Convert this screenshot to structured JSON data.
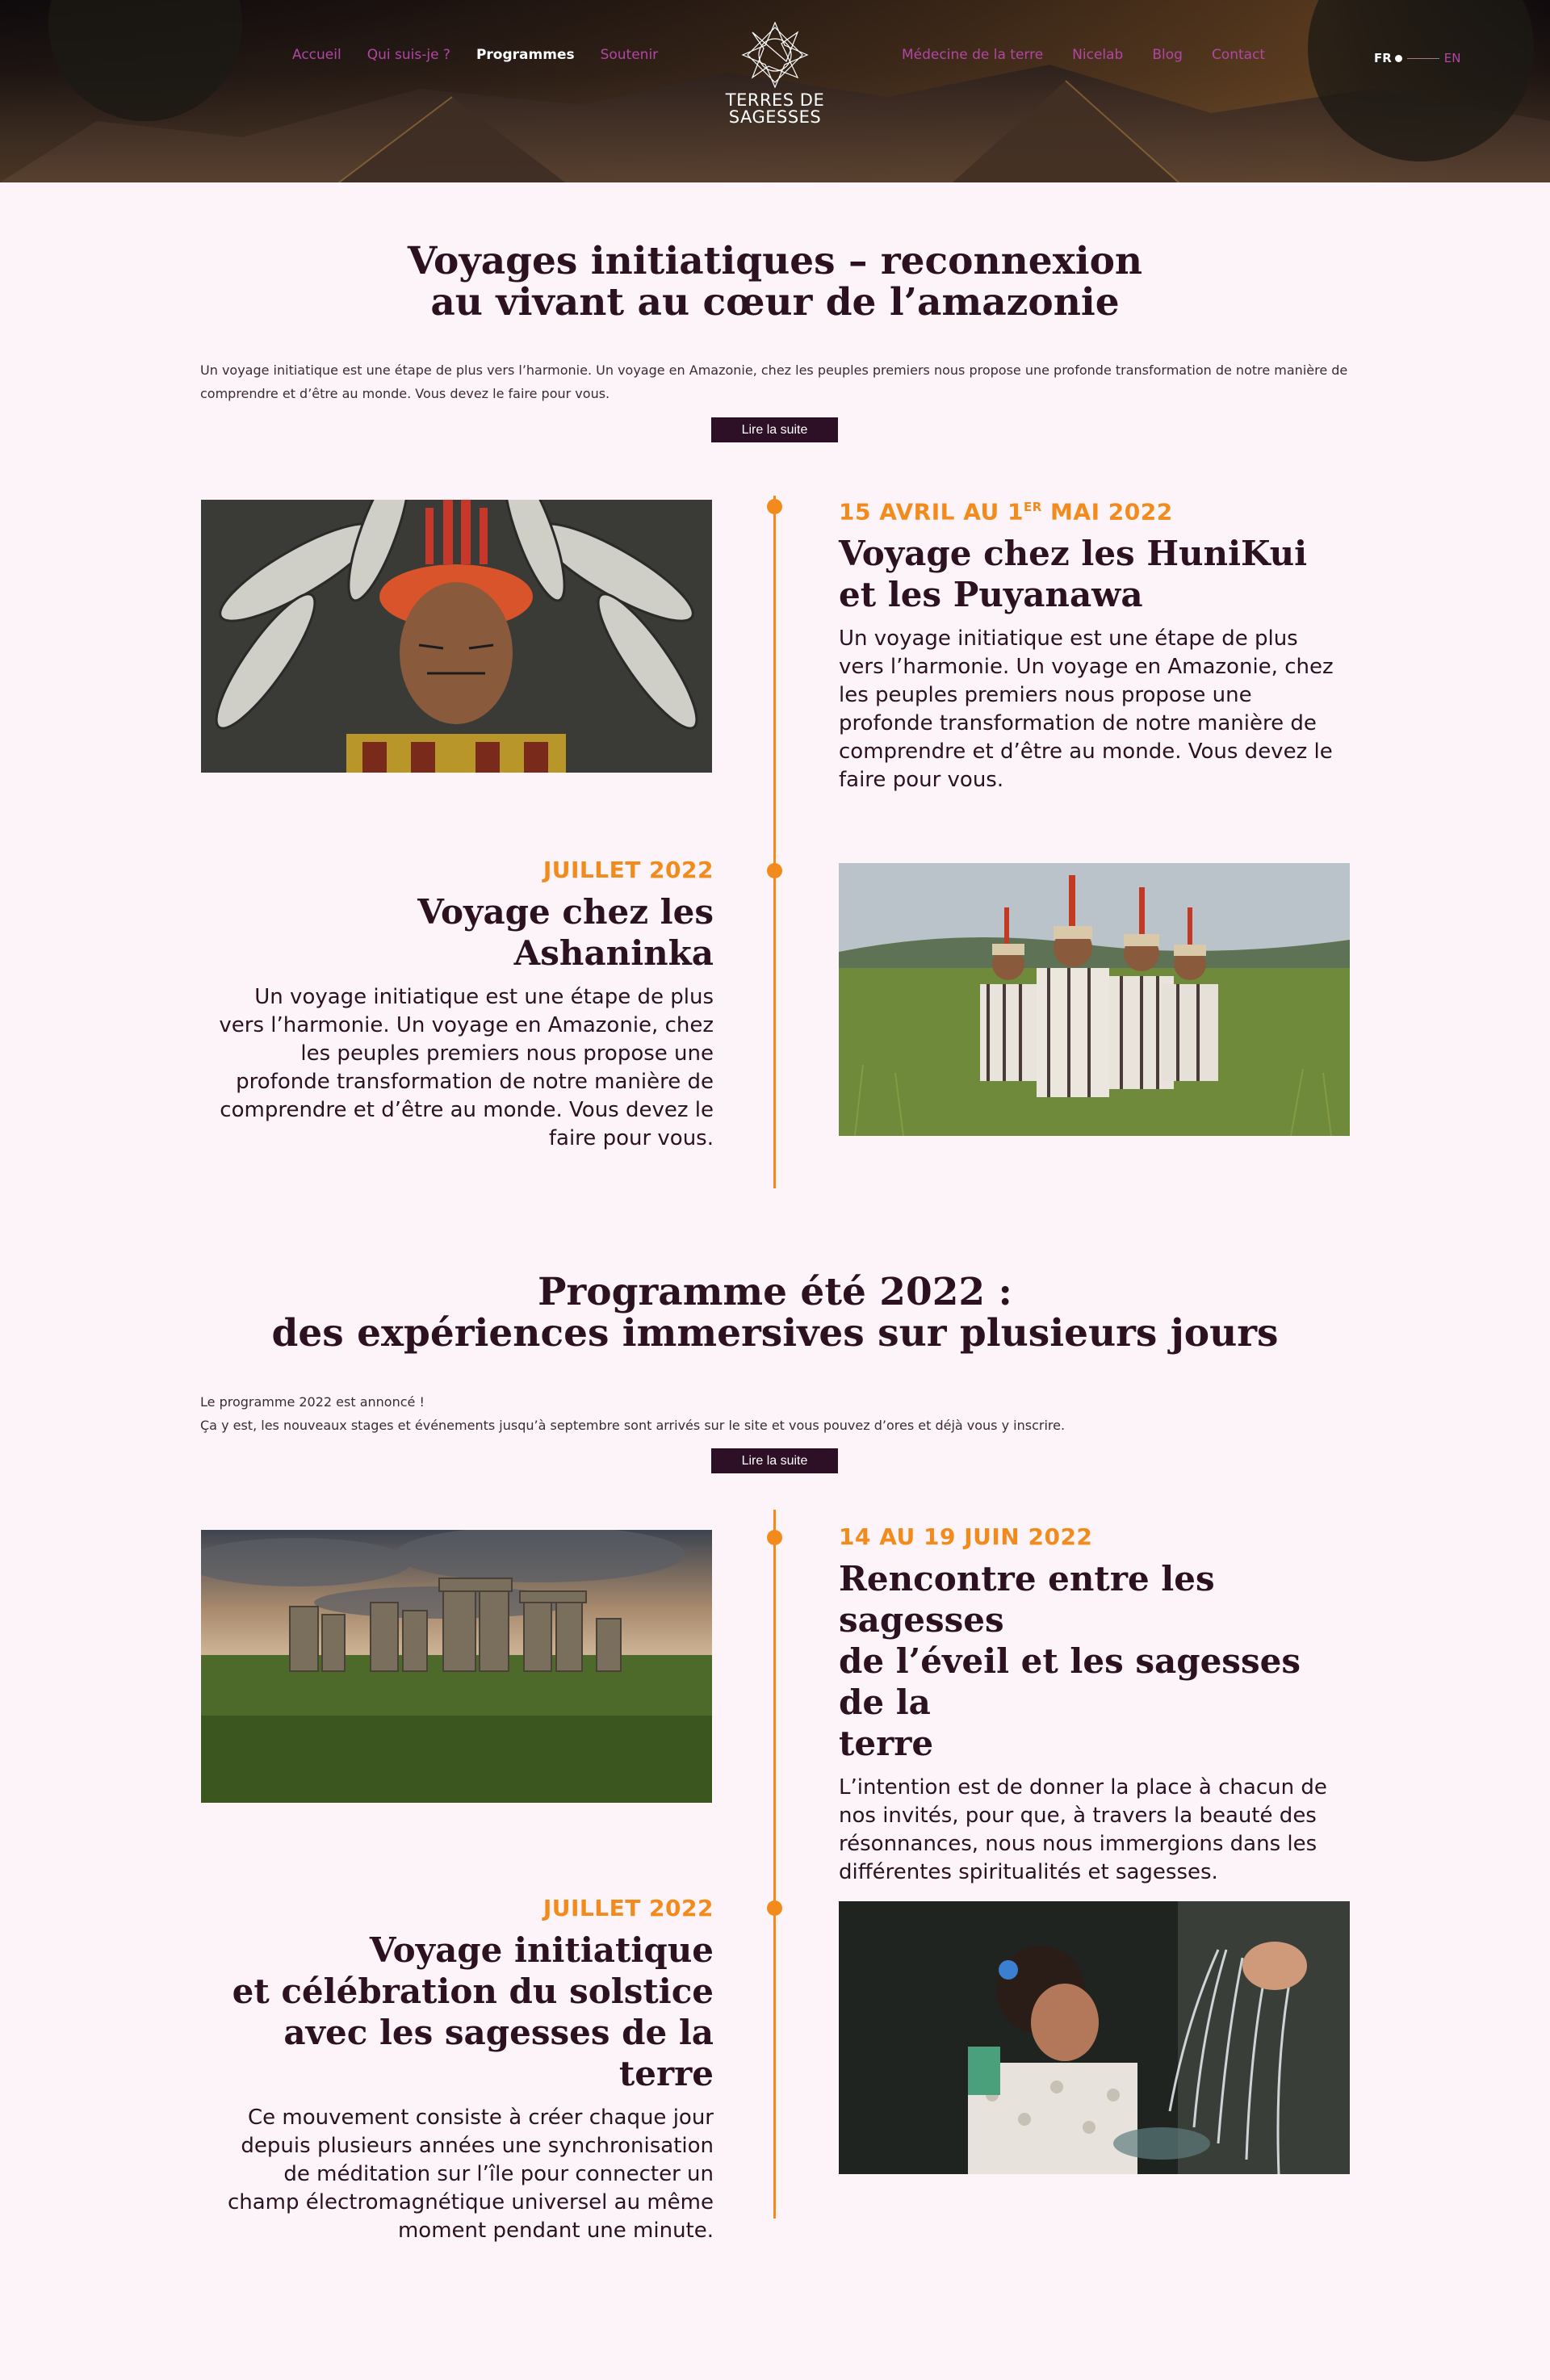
{
  "header": {
    "nav_left": [
      "Accueil",
      "Qui suis-je ?",
      "Programmes",
      "Soutenir"
    ],
    "nav_right": [
      "Médecine de la terre",
      "Nicelab",
      "Blog",
      "Contact"
    ],
    "active": "Programmes",
    "logo_line1": "TERRES DE",
    "logo_line2": "SAGESSES",
    "lang_current": "FR",
    "lang_other": "EN"
  },
  "section1": {
    "title_line1": "Voyages initiatiques – reconnexion",
    "title_line2": "au vivant au cœur de l’amazonie",
    "intro": "Un voyage initiatique est une étape de plus vers l’harmonie. Un voyage en Amazonie, chez les peuples premiers nous propose une profonde transformation de notre manière de comprendre et d’être au monde. Vous devez le faire pour vous.",
    "button": "Lire la suite",
    "entries": [
      {
        "date_pre": "15 AVRIL AU 1",
        "date_sup": "ER",
        "date_post": " MAI 2022",
        "title_line1": "Voyage chez les HuniKui",
        "title_line2": "et les Puyanawa",
        "desc": "Un voyage initiatique est une étape de plus vers l’harmonie. Un voyage en Amazonie, chez les peuples premiers nous propose une profonde transformation de notre manière de comprendre et d’être au monde. Vous devez le faire pour vous.",
        "image": "indigenous-man-feather-headdress"
      },
      {
        "date": "JUILLET 2022",
        "title_line1": "Voyage chez les",
        "title_line2": "Ashaninka",
        "desc": "Un voyage initiatique est une étape de plus vers l’harmonie. Un voyage en Amazonie, chez les peuples premiers nous propose une profonde transformation de notre manière de comprendre et d’être au monde. Vous devez le faire pour vous.",
        "image": "ashaninka-men-in-field"
      }
    ]
  },
  "section2": {
    "title_line1": "Programme été 2022 :",
    "title_line2": "des expériences immersives sur plusieurs jours",
    "intro_line1": "Le programme 2022 est annoncé !",
    "intro_line2": "Ça y est, les nouveaux stages et événements jusqu’à septembre sont arrivés sur le site et vous pouvez d’ores et déjà vous y inscrire.",
    "button": "Lire la suite",
    "entries": [
      {
        "date": "14 AU 19 JUIN 2022",
        "title_line1": "Rencontre entre les sagesses",
        "title_line2": "de l’éveil et les sagesses de la",
        "title_line3": "terre",
        "desc": "L’intention est de donner la place à chacun de nos invités, pour que, à travers la beauté des résonnances, nous nous immergions dans les différentes spiritualités et sagesses.",
        "image": "stonehenge"
      },
      {
        "date": "JUILLET 2022",
        "title_line1": "Voyage initiatique",
        "title_line2": "et célébration du solstice",
        "title_line3": "avec les sagesses de la terre",
        "desc": "Ce mouvement consiste à créer chaque jour depuis plusieurs années une synchronisation de méditation sur l’île pour connecter un champ électromagnétique universel au même moment pendant une minute.",
        "image": "water-purification-ritual"
      }
    ]
  },
  "colors": {
    "accent": "#f28a1c",
    "nav": "#b247a3",
    "dark": "#2c1220",
    "button": "#2e1026",
    "background": "#fcf4f8"
  }
}
